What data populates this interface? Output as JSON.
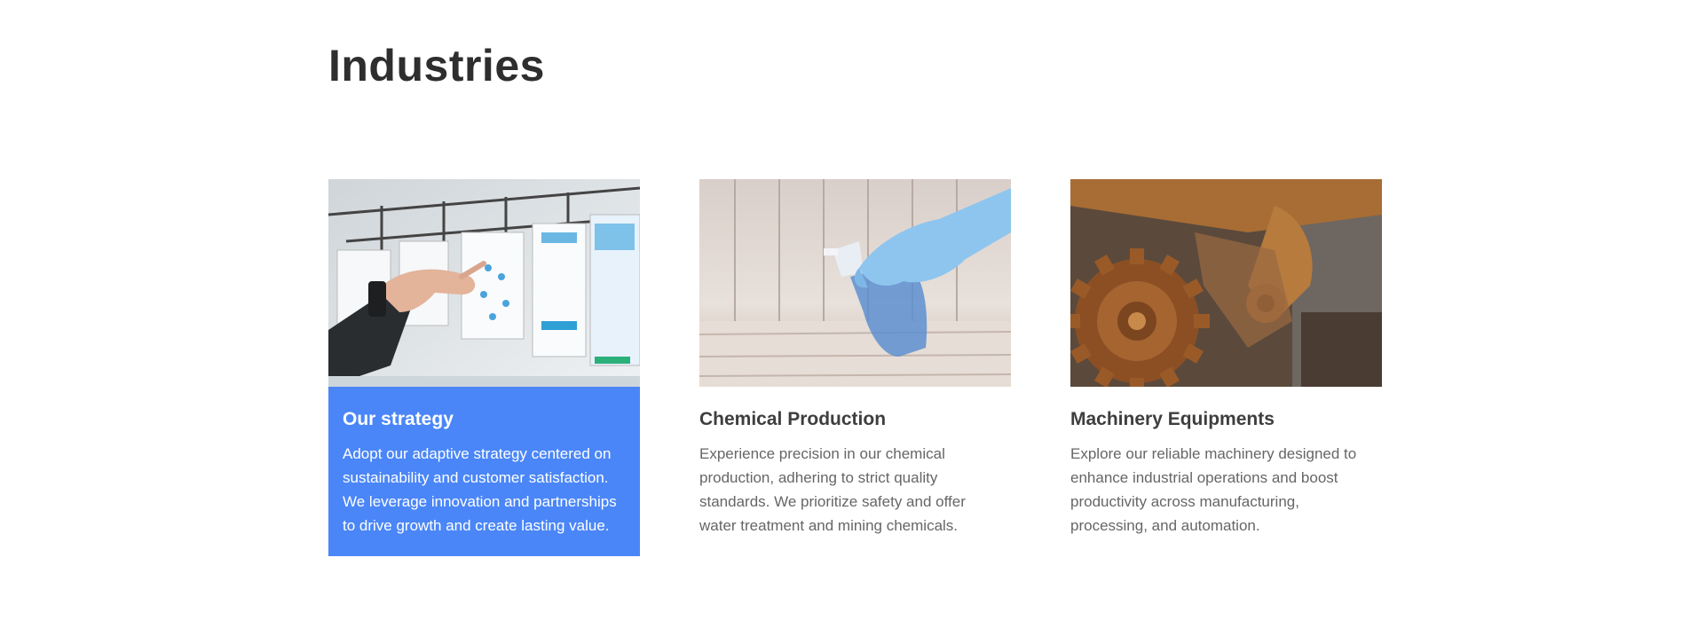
{
  "section": {
    "title": "Industries"
  },
  "cards": [
    {
      "title": "Our strategy",
      "text": "Adopt our adaptive strategy centered on sustainability and customer satisfaction. We leverage innovation and partnerships to drive growth and create lasting value.",
      "image": "planning-board-photo",
      "active": true
    },
    {
      "title": "Chemical Production",
      "text": "Experience precision in our chemical production, adhering to strict quality standards. We prioritize safety and offer water treatment and mining chemicals.",
      "image": "spray-bottle-photo",
      "active": false
    },
    {
      "title": "Machinery Equipments",
      "text": "Explore our reliable machinery designed to enhance industrial operations and boost productivity across manufacturing, processing, and automation.",
      "image": "rusty-gear-photo",
      "active": false
    }
  ],
  "colors": {
    "accent": "#4a86f7",
    "heading": "#2e2e2e",
    "body_text": "#666666"
  }
}
